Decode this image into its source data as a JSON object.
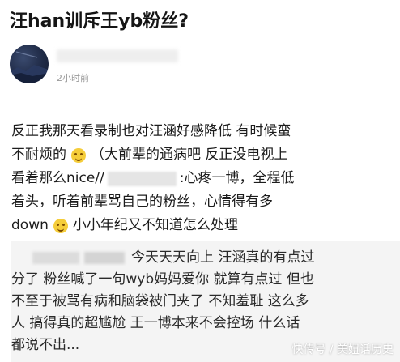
{
  "title": "汪han训斥王yb粉丝?",
  "post": {
    "time": "2小时前",
    "lines": [
      "反正我那天看录制也对汪涵好感降低 有时候蛮",
      "不耐烦的",
      "（大前辈的通病吧 反正没电视上",
      "看着那么nice//",
      ":心疼一博，全程低",
      "着头，听着前辈骂自己的粉丝，心情得有多",
      "down",
      "小小年纪又不知道怎么处理"
    ]
  },
  "quote": {
    "lines": [
      "今天天天向上 汪涵真的有点过",
      "分了 粉丝喊了一句wyb妈妈爱你 就算有点过 但也",
      "不至于被骂有病和脑袋被门夹了 不知羞耻 这么多",
      "人 搞得真的超尴尬 王一博本来不会控场 什么话",
      "都说不出..."
    ]
  },
  "watermark": "快传号 / 美妞话历史",
  "icons": {
    "avatar": "avatar-icon",
    "emoji1": "smile-emoji-icon",
    "emoji2": "smile-emoji-icon"
  },
  "colors": {
    "background": "#ffffff",
    "quote_bg": "#f4f4f4",
    "time": "#999999"
  }
}
